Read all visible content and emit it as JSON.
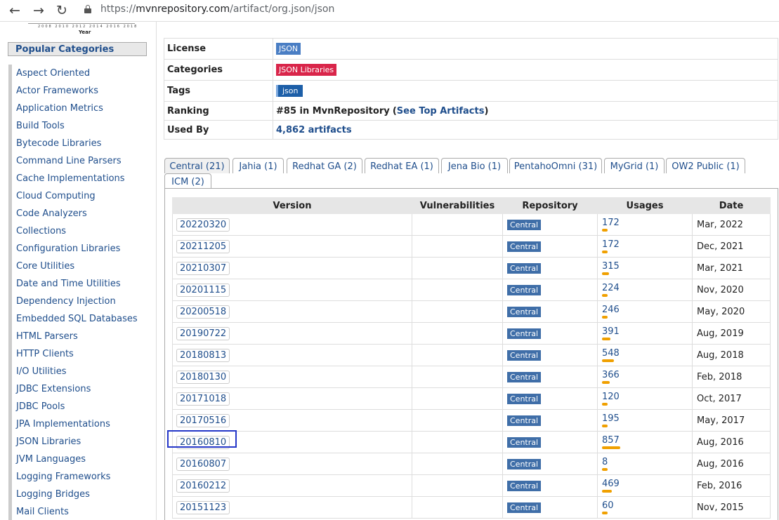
{
  "browser": {
    "back_icon": "arrow-left-icon",
    "forward_icon": "arrow-right-icon",
    "reload_icon": "reload-icon",
    "url_prefix": "https://",
    "url_host": "mvnrepository.com",
    "url_path": "/artifact/org.json/json"
  },
  "mini_chart": {
    "ticks": "2008 2010 2012 2014 2016 2018",
    "year_label": "Year"
  },
  "sidebar": {
    "popular_title": "Popular Categories",
    "items": [
      "Aspect Oriented",
      "Actor Frameworks",
      "Application Metrics",
      "Build Tools",
      "Bytecode Libraries",
      "Command Line Parsers",
      "Cache Implementations",
      "Cloud Computing",
      "Code Analyzers",
      "Collections",
      "Configuration Libraries",
      "Core Utilities",
      "Date and Time Utilities",
      "Dependency Injection",
      "Embedded SQL Databases",
      "HTML Parsers",
      "HTTP Clients",
      "I/O Utilities",
      "JDBC Extensions",
      "JDBC Pools",
      "JPA Implementations",
      "JSON Libraries",
      "JVM Languages",
      "Logging Frameworks",
      "Logging Bridges",
      "Mail Clients"
    ]
  },
  "info": {
    "license_label": "License",
    "license_value": "JSON",
    "categories_label": "Categories",
    "categories_value": "JSON Libraries",
    "tags_label": "Tags",
    "tags_value": "json",
    "ranking_label": "Ranking",
    "ranking_value": "#85 in MvnRepository",
    "ranking_link": "See Top Artifacts",
    "ranking_open": "(",
    "ranking_close": ")",
    "usedby_label": "Used By",
    "usedby_value": "4,862 artifacts"
  },
  "tabs": [
    "Central (21)",
    "Jahia (1)",
    "Redhat GA (2)",
    "Redhat EA (1)",
    "Jena Bio (1)",
    "PentahoOmni (31)",
    "MyGrid (1)",
    "OW2 Public (1)",
    "ICM (2)"
  ],
  "versions_table": {
    "headers": [
      "Version",
      "Vulnerabilities",
      "Repository",
      "Usages",
      "Date"
    ],
    "rows": [
      {
        "version": "20220320",
        "repo": "Central",
        "usages": "172",
        "usage_value": 172,
        "date": "Mar, 2022"
      },
      {
        "version": "20211205",
        "repo": "Central",
        "usages": "172",
        "usage_value": 172,
        "date": "Dec, 2021"
      },
      {
        "version": "20210307",
        "repo": "Central",
        "usages": "315",
        "usage_value": 315,
        "date": "Mar, 2021"
      },
      {
        "version": "20201115",
        "repo": "Central",
        "usages": "224",
        "usage_value": 224,
        "date": "Nov, 2020"
      },
      {
        "version": "20200518",
        "repo": "Central",
        "usages": "246",
        "usage_value": 246,
        "date": "May, 2020"
      },
      {
        "version": "20190722",
        "repo": "Central",
        "usages": "391",
        "usage_value": 391,
        "date": "Aug, 2019"
      },
      {
        "version": "20180813",
        "repo": "Central",
        "usages": "548",
        "usage_value": 548,
        "date": "Aug, 2018"
      },
      {
        "version": "20180130",
        "repo": "Central",
        "usages": "366",
        "usage_value": 366,
        "date": "Feb, 2018"
      },
      {
        "version": "20171018",
        "repo": "Central",
        "usages": "120",
        "usage_value": 120,
        "date": "Oct, 2017"
      },
      {
        "version": "20170516",
        "repo": "Central",
        "usages": "195",
        "usage_value": 195,
        "date": "May, 2017"
      },
      {
        "version": "20160810",
        "repo": "Central",
        "usages": "857",
        "usage_value": 857,
        "date": "Aug, 2016"
      },
      {
        "version": "20160807",
        "repo": "Central",
        "usages": "8",
        "usage_value": 8,
        "date": "Aug, 2016"
      },
      {
        "version": "20160212",
        "repo": "Central",
        "usages": "469",
        "usage_value": 469,
        "date": "Feb, 2016"
      },
      {
        "version": "20151123",
        "repo": "Central",
        "usages": "60",
        "usage_value": 60,
        "date": "Nov, 2015"
      }
    ],
    "max_usage": 857
  }
}
